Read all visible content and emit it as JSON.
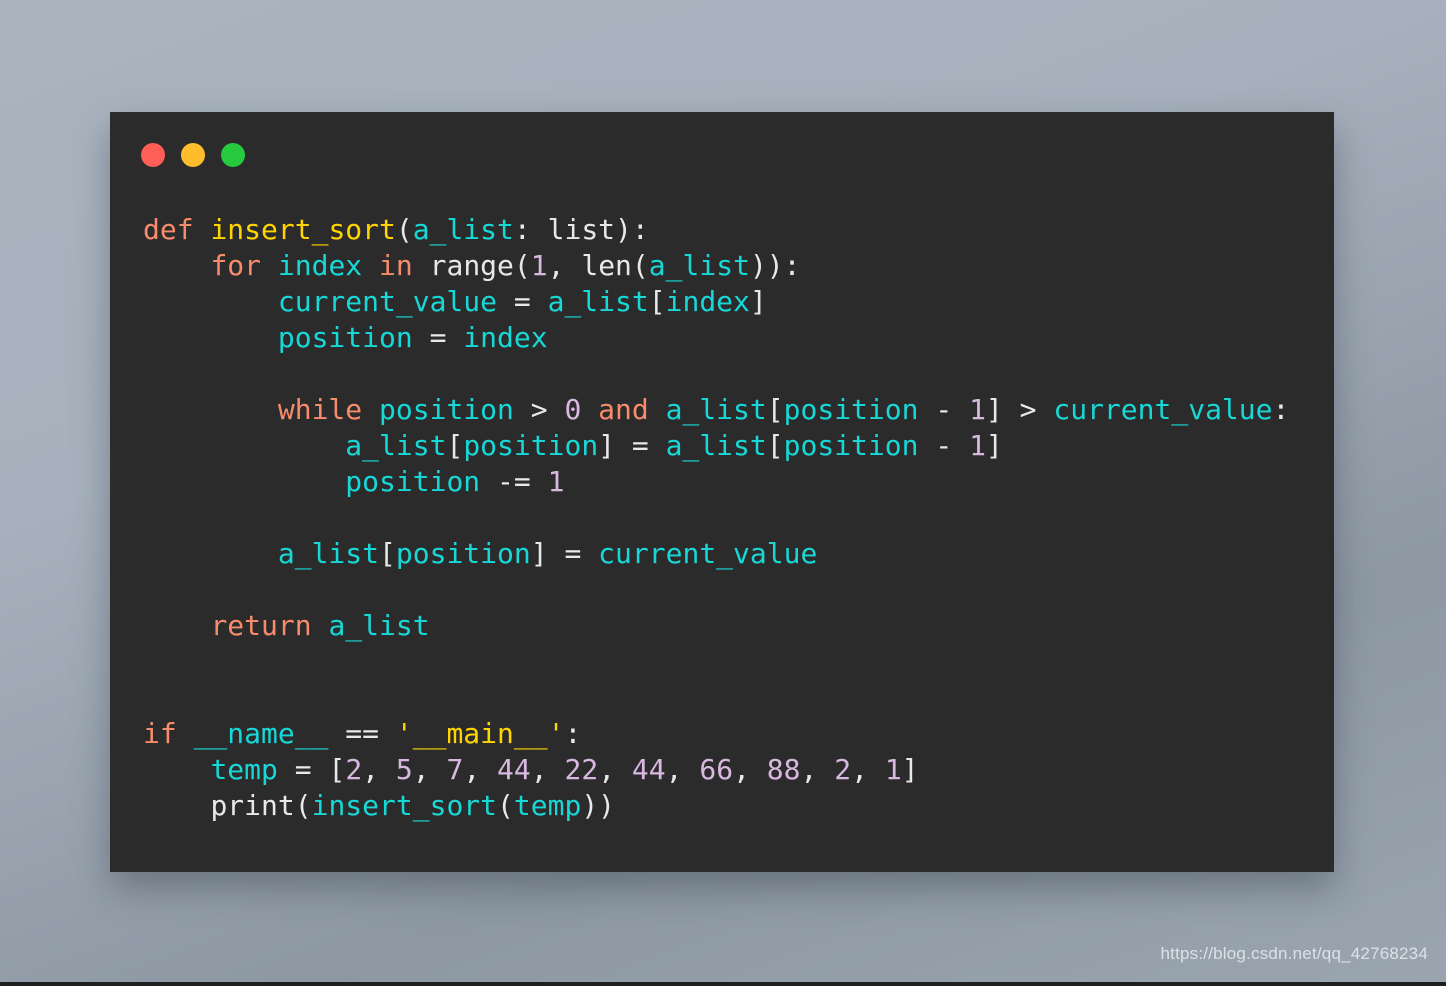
{
  "window": {
    "background_color": "#2b2b2b",
    "page_background_color": "#a7b1bd",
    "controls": [
      {
        "name": "close",
        "color": "#ff5f56"
      },
      {
        "name": "minimize",
        "color": "#ffbd2e"
      },
      {
        "name": "maximize",
        "color": "#27c93f"
      }
    ]
  },
  "theme": {
    "keyword_color": "#f78c6c",
    "function_color": "#ffd500",
    "identifier_color": "#18d7d7",
    "builtin_color": "#e8e8e8",
    "number_color": "#d8b8e0",
    "string_color": "#ffd500"
  },
  "code": {
    "language": "python",
    "indent_size": 4,
    "lines": [
      "def insert_sort(a_list: list):",
      "    for index in range(1, len(a_list)):",
      "        current_value = a_list[index]",
      "        position = index",
      "",
      "        while position > 0 and a_list[position - 1] > current_value:",
      "            a_list[position] = a_list[position - 1]",
      "            position -= 1",
      "",
      "        a_list[position] = current_value",
      "",
      "    return a_list",
      "",
      "",
      "if __name__ == '__main__':",
      "    temp = [2, 5, 7, 44, 22, 44, 66, 88, 2, 1]",
      "    print(insert_sort(temp))"
    ],
    "tokens": {
      "keywords": [
        "def",
        "for",
        "in",
        "while",
        "and",
        "return",
        "if"
      ],
      "function_name": "insert_sort",
      "identifiers": [
        "a_list",
        "index",
        "current_value",
        "position",
        "__name__",
        "temp"
      ],
      "builtins": [
        "list",
        "range",
        "len",
        "print"
      ],
      "numbers": [
        "1",
        "0",
        "2",
        "5",
        "7",
        "44",
        "22",
        "44",
        "66",
        "88",
        "2",
        "1"
      ],
      "strings": [
        "'__main__'"
      ],
      "list_literal_values": [
        2,
        5,
        7,
        44,
        22,
        44,
        66,
        88,
        2,
        1
      ]
    }
  },
  "watermark": {
    "text": "https://blog.csdn.net/qq_42768234"
  }
}
